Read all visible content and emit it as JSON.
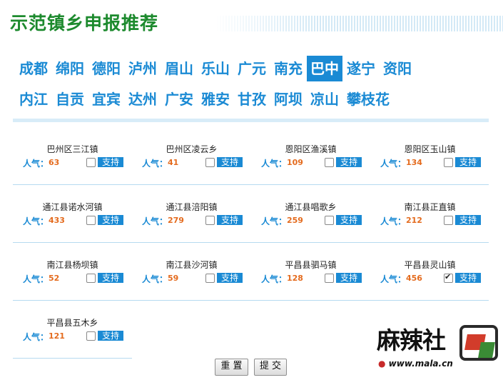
{
  "title": "示范镇乡申报推荐",
  "colors": {
    "accent": "#1a8ad4",
    "title": "#1d8a2e",
    "count": "#e46b1e"
  },
  "cities": [
    {
      "label": "成都",
      "active": false
    },
    {
      "label": "绵阳",
      "active": false
    },
    {
      "label": "德阳",
      "active": false
    },
    {
      "label": "泸州",
      "active": false
    },
    {
      "label": "眉山",
      "active": false
    },
    {
      "label": "乐山",
      "active": false
    },
    {
      "label": "广元",
      "active": false
    },
    {
      "label": "南充",
      "active": false
    },
    {
      "label": "巴中",
      "active": true
    },
    {
      "label": "遂宁",
      "active": false
    },
    {
      "label": "资阳",
      "active": false
    },
    {
      "label": "内江",
      "active": false
    },
    {
      "label": "自贡",
      "active": false
    },
    {
      "label": "宜宾",
      "active": false
    },
    {
      "label": "达州",
      "active": false
    },
    {
      "label": "广安",
      "active": false
    },
    {
      "label": "雅安",
      "active": false
    },
    {
      "label": "甘孜",
      "active": false
    },
    {
      "label": "阿坝",
      "active": false
    },
    {
      "label": "凉山",
      "active": false
    },
    {
      "label": "攀枝花",
      "active": false
    }
  ],
  "popularity_label": "人气：",
  "support_label": "支持",
  "towns": [
    {
      "name": "巴州区三江镇",
      "count": "63",
      "checked": false
    },
    {
      "name": "巴州区凌云乡",
      "count": "41",
      "checked": false
    },
    {
      "name": "恩阳区渔溪镇",
      "count": "109",
      "checked": false
    },
    {
      "name": "恩阳区玉山镇",
      "count": "134",
      "checked": false
    },
    {
      "name": "通江县诺水河镇",
      "count": "433",
      "checked": false
    },
    {
      "name": "通江县涪阳镇",
      "count": "279",
      "checked": false
    },
    {
      "name": "通江县唱歌乡",
      "count": "259",
      "checked": false
    },
    {
      "name": "南江县正直镇",
      "count": "212",
      "checked": false
    },
    {
      "name": "南江县杨坝镇",
      "count": "52",
      "checked": false
    },
    {
      "name": "南江县沙河镇",
      "count": "59",
      "checked": false
    },
    {
      "name": "平昌县驷马镇",
      "count": "128",
      "checked": false
    },
    {
      "name": "平昌县灵山镇",
      "count": "456",
      "checked": true
    },
    {
      "name": "平昌县五木乡",
      "count": "121",
      "checked": false
    }
  ],
  "buttons": {
    "reset": "重 置",
    "submit": "提 交"
  },
  "watermark": {
    "text": "麻辣社区",
    "url": "www.mala.cn"
  }
}
